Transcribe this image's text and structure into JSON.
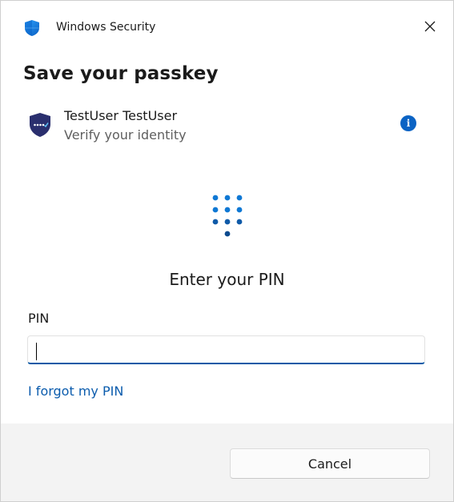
{
  "window": {
    "title": "Windows Security",
    "app_icon": "shield-icon",
    "close_icon": "close-icon",
    "accent": "#0b63c4"
  },
  "dialog": {
    "heading": "Save your passkey"
  },
  "account": {
    "name": "TestUser TestUser",
    "subtitle": "Verify your identity",
    "icon": "passkey-shield-icon",
    "info_icon_glyph": "i"
  },
  "pin": {
    "keypad_icon": "keypad-icon",
    "prompt": "Enter your PIN",
    "label": "PIN",
    "value": "",
    "forgot_link": "I forgot my PIN"
  },
  "footer": {
    "cancel_label": "Cancel"
  }
}
